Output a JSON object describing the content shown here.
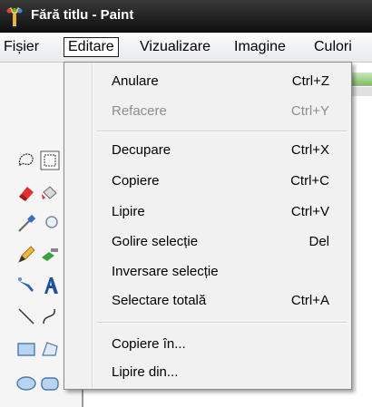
{
  "window": {
    "title": "Fără titlu - Paint"
  },
  "menubar": {
    "items": [
      {
        "label": "Fișier"
      },
      {
        "label": "Editare"
      },
      {
        "label": "Vizualizare"
      },
      {
        "label": "Imagine"
      },
      {
        "label": "Culori"
      }
    ],
    "active": "Editare"
  },
  "edit_menu": {
    "groups": [
      [
        {
          "label": "Anulare",
          "shortcut": "Ctrl+Z",
          "enabled": true
        },
        {
          "label": "Refacere",
          "shortcut": "Ctrl+Y",
          "enabled": false
        }
      ],
      [
        {
          "label": "Decupare",
          "shortcut": "Ctrl+X",
          "enabled": true
        },
        {
          "label": "Copiere",
          "shortcut": "Ctrl+C",
          "enabled": true
        },
        {
          "label": "Lipire",
          "shortcut": "Ctrl+V",
          "enabled": true
        },
        {
          "label": "Golire selecție",
          "shortcut": "Del",
          "enabled": true
        },
        {
          "label": "Inversare selecție",
          "shortcut": "",
          "enabled": true
        },
        {
          "label": "Selectare totală",
          "shortcut": "Ctrl+A",
          "enabled": true
        }
      ],
      [
        {
          "label": "Copiere în...",
          "shortcut": "",
          "enabled": true
        },
        {
          "label": "Lipire din...",
          "shortcut": "",
          "enabled": true
        }
      ]
    ]
  },
  "toolbox": {
    "tools": [
      "free-form-select-icon",
      "select-icon",
      "eraser-icon",
      "fill-icon",
      "color-picker-icon",
      "magnifier-icon",
      "pencil-icon",
      "brush-icon",
      "airbrush-icon",
      "text-icon",
      "line-icon",
      "curve-icon",
      "rectangle-icon",
      "polygon-icon",
      "ellipse-icon",
      "rounded-rectangle-icon"
    ]
  },
  "colors": {
    "titlebar": "#1a1a1a",
    "menu_bg": "#f1f1f1",
    "disabled_text": "#8d8d8d"
  }
}
